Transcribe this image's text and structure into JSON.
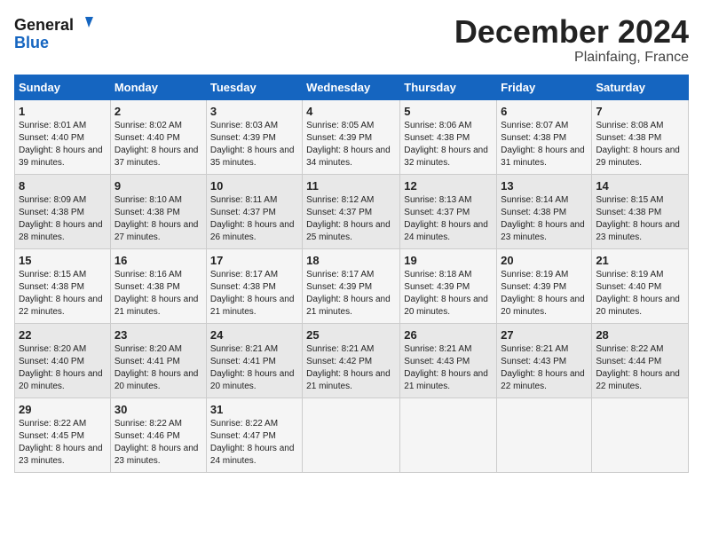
{
  "logo": {
    "line1": "General",
    "line2": "Blue"
  },
  "title": "December 2024",
  "location": "Plainfaing, France",
  "days_header": [
    "Sunday",
    "Monday",
    "Tuesday",
    "Wednesday",
    "Thursday",
    "Friday",
    "Saturday"
  ],
  "weeks": [
    [
      {
        "day": "1",
        "sunrise": "8:01 AM",
        "sunset": "4:40 PM",
        "daylight": "8 hours and 39 minutes."
      },
      {
        "day": "2",
        "sunrise": "8:02 AM",
        "sunset": "4:40 PM",
        "daylight": "8 hours and 37 minutes."
      },
      {
        "day": "3",
        "sunrise": "8:03 AM",
        "sunset": "4:39 PM",
        "daylight": "8 hours and 35 minutes."
      },
      {
        "day": "4",
        "sunrise": "8:05 AM",
        "sunset": "4:39 PM",
        "daylight": "8 hours and 34 minutes."
      },
      {
        "day": "5",
        "sunrise": "8:06 AM",
        "sunset": "4:38 PM",
        "daylight": "8 hours and 32 minutes."
      },
      {
        "day": "6",
        "sunrise": "8:07 AM",
        "sunset": "4:38 PM",
        "daylight": "8 hours and 31 minutes."
      },
      {
        "day": "7",
        "sunrise": "8:08 AM",
        "sunset": "4:38 PM",
        "daylight": "8 hours and 29 minutes."
      }
    ],
    [
      {
        "day": "8",
        "sunrise": "8:09 AM",
        "sunset": "4:38 PM",
        "daylight": "8 hours and 28 minutes."
      },
      {
        "day": "9",
        "sunrise": "8:10 AM",
        "sunset": "4:38 PM",
        "daylight": "8 hours and 27 minutes."
      },
      {
        "day": "10",
        "sunrise": "8:11 AM",
        "sunset": "4:37 PM",
        "daylight": "8 hours and 26 minutes."
      },
      {
        "day": "11",
        "sunrise": "8:12 AM",
        "sunset": "4:37 PM",
        "daylight": "8 hours and 25 minutes."
      },
      {
        "day": "12",
        "sunrise": "8:13 AM",
        "sunset": "4:37 PM",
        "daylight": "8 hours and 24 minutes."
      },
      {
        "day": "13",
        "sunrise": "8:14 AM",
        "sunset": "4:38 PM",
        "daylight": "8 hours and 23 minutes."
      },
      {
        "day": "14",
        "sunrise": "8:15 AM",
        "sunset": "4:38 PM",
        "daylight": "8 hours and 23 minutes."
      }
    ],
    [
      {
        "day": "15",
        "sunrise": "8:15 AM",
        "sunset": "4:38 PM",
        "daylight": "8 hours and 22 minutes."
      },
      {
        "day": "16",
        "sunrise": "8:16 AM",
        "sunset": "4:38 PM",
        "daylight": "8 hours and 21 minutes."
      },
      {
        "day": "17",
        "sunrise": "8:17 AM",
        "sunset": "4:38 PM",
        "daylight": "8 hours and 21 minutes."
      },
      {
        "day": "18",
        "sunrise": "8:17 AM",
        "sunset": "4:39 PM",
        "daylight": "8 hours and 21 minutes."
      },
      {
        "day": "19",
        "sunrise": "8:18 AM",
        "sunset": "4:39 PM",
        "daylight": "8 hours and 20 minutes."
      },
      {
        "day": "20",
        "sunrise": "8:19 AM",
        "sunset": "4:39 PM",
        "daylight": "8 hours and 20 minutes."
      },
      {
        "day": "21",
        "sunrise": "8:19 AM",
        "sunset": "4:40 PM",
        "daylight": "8 hours and 20 minutes."
      }
    ],
    [
      {
        "day": "22",
        "sunrise": "8:20 AM",
        "sunset": "4:40 PM",
        "daylight": "8 hours and 20 minutes."
      },
      {
        "day": "23",
        "sunrise": "8:20 AM",
        "sunset": "4:41 PM",
        "daylight": "8 hours and 20 minutes."
      },
      {
        "day": "24",
        "sunrise": "8:21 AM",
        "sunset": "4:41 PM",
        "daylight": "8 hours and 20 minutes."
      },
      {
        "day": "25",
        "sunrise": "8:21 AM",
        "sunset": "4:42 PM",
        "daylight": "8 hours and 21 minutes."
      },
      {
        "day": "26",
        "sunrise": "8:21 AM",
        "sunset": "4:43 PM",
        "daylight": "8 hours and 21 minutes."
      },
      {
        "day": "27",
        "sunrise": "8:21 AM",
        "sunset": "4:43 PM",
        "daylight": "8 hours and 22 minutes."
      },
      {
        "day": "28",
        "sunrise": "8:22 AM",
        "sunset": "4:44 PM",
        "daylight": "8 hours and 22 minutes."
      }
    ],
    [
      {
        "day": "29",
        "sunrise": "8:22 AM",
        "sunset": "4:45 PM",
        "daylight": "8 hours and 23 minutes."
      },
      {
        "day": "30",
        "sunrise": "8:22 AM",
        "sunset": "4:46 PM",
        "daylight": "8 hours and 23 minutes."
      },
      {
        "day": "31",
        "sunrise": "8:22 AM",
        "sunset": "4:47 PM",
        "daylight": "8 hours and 24 minutes."
      },
      null,
      null,
      null,
      null
    ]
  ],
  "labels": {
    "sunrise": "Sunrise:",
    "sunset": "Sunset:",
    "daylight": "Daylight:"
  }
}
